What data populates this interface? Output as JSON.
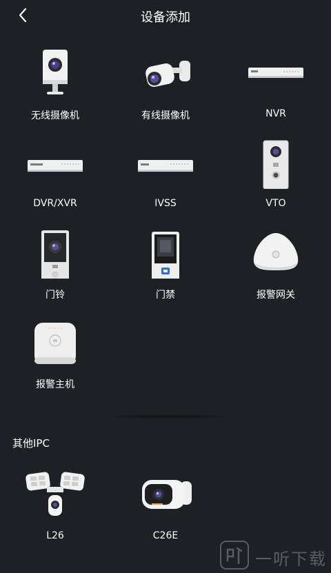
{
  "header": {
    "title": "设备添加"
  },
  "devices": [
    {
      "label": "无线摄像机",
      "icon": "wireless-camera-icon"
    },
    {
      "label": "有线摄像机",
      "icon": "wired-camera-icon"
    },
    {
      "label": "NVR",
      "icon": "nvr-icon"
    },
    {
      "label": "DVR/XVR",
      "icon": "dvr-icon"
    },
    {
      "label": "IVSS",
      "icon": "ivss-icon"
    },
    {
      "label": "VTO",
      "icon": "vto-icon"
    },
    {
      "label": "门铃",
      "icon": "doorbell-icon"
    },
    {
      "label": "门禁",
      "icon": "access-control-icon"
    },
    {
      "label": "报警网关",
      "icon": "alarm-gateway-icon"
    },
    {
      "label": "报警主机",
      "icon": "alarm-host-icon"
    }
  ],
  "other_ipc": {
    "title": "其他IPC",
    "items": [
      {
        "label": "L26",
        "icon": "floodlight-camera-icon"
      },
      {
        "label": "C26E",
        "icon": "c26e-camera-icon"
      }
    ]
  },
  "watermark": {
    "text": "一听下载"
  },
  "colors": {
    "background": "#1d2024",
    "text": "#ffffff",
    "device_white": "#eeeeee"
  }
}
